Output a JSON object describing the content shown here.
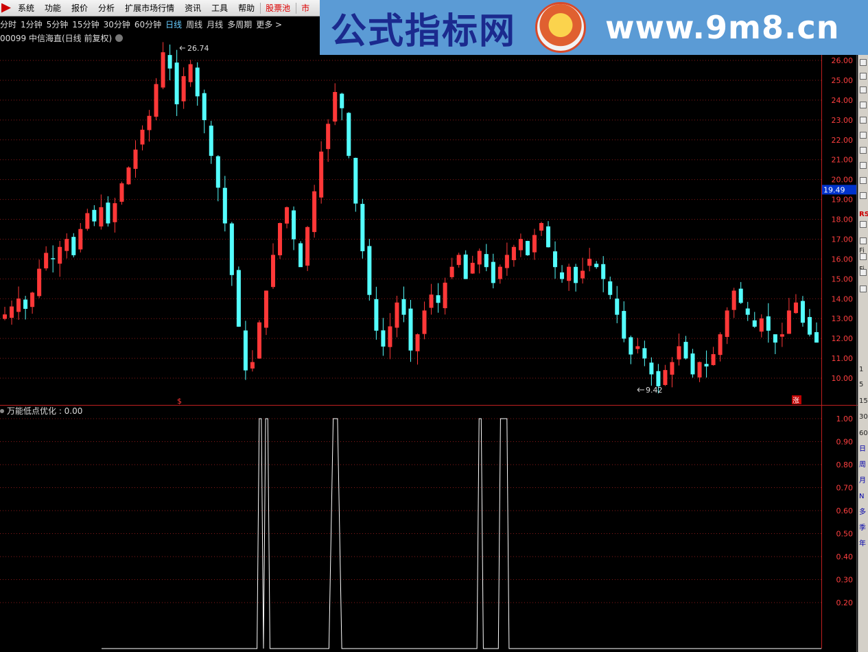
{
  "menu": [
    "系统",
    "功能",
    "报价",
    "分析",
    "扩展市场行情",
    "资讯",
    "工具",
    "帮助",
    "股票池",
    "市"
  ],
  "periods": [
    "分时",
    "1分钟",
    "5分钟",
    "15分钟",
    "30分钟",
    "60分钟",
    "日线",
    "周线",
    "月线",
    "多周期",
    "更多 >"
  ],
  "active_period": "日线",
  "stock_title": "00099 中信海直(日线 前复权)",
  "watermark": {
    "cn": "公式指标网",
    "url": "www.9m8.cn"
  },
  "colors": {
    "up": "#ff3838",
    "down": "#54ffff",
    "grid": "#8b1a1a",
    "axis": "#c02020",
    "indicator": "#ffffff",
    "price_box": "#0033cc"
  },
  "chart_data": [
    {
      "type": "candlestick",
      "title": "00099 中信海直(日线 前复权)",
      "y_ticks": [
        "10.00",
        "11.00",
        "12.00",
        "13.00",
        "14.00",
        "15.00",
        "16.00",
        "17.00",
        "18.00",
        "19.00",
        "20.00",
        "21.00",
        "22.00",
        "23.00",
        "24.00",
        "25.00",
        "26.00"
      ],
      "ylim": [
        9.0,
        26.7
      ],
      "current_price": "19.49",
      "high_label": "26.74",
      "low_label": "9.42",
      "markers": [
        "$",
        "涨"
      ],
      "close_path": [
        13.2,
        13.6,
        14.0,
        13.5,
        14.3,
        15.5,
        16.3,
        16.0,
        16.6,
        17.0,
        16.2,
        17.5,
        18.3,
        17.9,
        18.6,
        17.8,
        18.8,
        19.8,
        20.6,
        21.5,
        22.5,
        23.2,
        24.8,
        26.4,
        25.6,
        23.8,
        25.2,
        25.8,
        24.2,
        23.0,
        21.2,
        19.6,
        17.8,
        15.2,
        12.6,
        10.4,
        10.8,
        12.8,
        14.4,
        16.2,
        17.8,
        18.6,
        17.0,
        15.6,
        17.6,
        19.4,
        21.4,
        22.8,
        24.4,
        23.6,
        21.2,
        18.8,
        16.4,
        14.2,
        12.4,
        11.6,
        12.6,
        13.8,
        13.2,
        11.4,
        12.2,
        13.4,
        14.2,
        13.8,
        14.8,
        15.6,
        16.2,
        15.0,
        15.8,
        16.4,
        15.6,
        14.8,
        15.6,
        16.2,
        16.6,
        17.0,
        16.2,
        17.2,
        17.8,
        16.6,
        15.6,
        15.0,
        15.6,
        14.8,
        15.4,
        16.0,
        15.6,
        15.0,
        14.2,
        13.2,
        12.0,
        11.2,
        11.6,
        11.0,
        10.2,
        9.6,
        10.4,
        10.8,
        11.6,
        11.0,
        10.2,
        10.8,
        10.6,
        11.2,
        12.2,
        13.4,
        14.4,
        13.8,
        13.2,
        12.6,
        13.0,
        12.4,
        11.8,
        12.2,
        13.4,
        13.8,
        12.8,
        12.2,
        11.8
      ],
      "panel": "price"
    },
    {
      "type": "line",
      "title": "万能低点优化",
      "value_label": "万能低点优化 : 0.00",
      "y_ticks": [
        "0.20",
        "0.30",
        "0.40",
        "0.50",
        "0.60",
        "0.70",
        "0.80",
        "0.90",
        "1.00"
      ],
      "ylim": [
        0,
        1.0
      ],
      "x": [
        0.0,
        0.27,
        0.29,
        0.294,
        0.298,
        0.302,
        0.306,
        0.31,
        0.314,
        0.424,
        0.432,
        0.436,
        0.44,
        0.448,
        0.7,
        0.704,
        0.708,
        0.712,
        0.74,
        0.744,
        0.752,
        0.756,
        0.76,
        1.0
      ],
      "values": [
        0,
        0,
        0,
        1,
        1,
        0,
        1,
        1,
        0,
        0,
        1,
        1,
        1,
        0,
        0,
        1,
        1,
        0,
        0,
        1,
        1,
        1,
        0,
        0
      ],
      "panel": "indicator"
    }
  ],
  "right_tools": [
    "RS",
    "Fi",
    "Fi",
    "1",
    "5",
    "15",
    "30",
    "60",
    "日",
    "周",
    "月",
    "N",
    "多",
    "季",
    "年"
  ]
}
